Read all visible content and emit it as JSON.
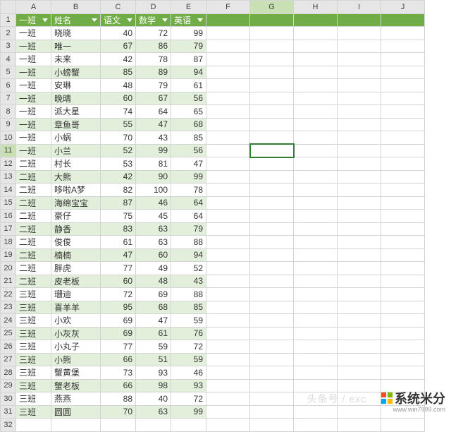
{
  "columns": [
    "A",
    "B",
    "C",
    "D",
    "E",
    "F",
    "G",
    "H",
    "I",
    "J"
  ],
  "col_classes": [
    "cA",
    "cB",
    "cC",
    "cD",
    "cE",
    "cF",
    "cG",
    "cH",
    "cI",
    "cJ"
  ],
  "header_row": [
    "一班",
    "姓名",
    "语文",
    "数学",
    "英语"
  ],
  "selected": {
    "row": 11,
    "col": "G"
  },
  "rows": [
    {
      "n": 2,
      "band": false,
      "c": [
        "一班",
        "晓晓",
        "40",
        "72",
        "99"
      ]
    },
    {
      "n": 3,
      "band": true,
      "c": [
        "一班",
        "唯一",
        "67",
        "86",
        "79"
      ]
    },
    {
      "n": 4,
      "band": false,
      "c": [
        "一班",
        "未来",
        "42",
        "78",
        "87"
      ]
    },
    {
      "n": 5,
      "band": true,
      "c": [
        "一班",
        "小螃蟹",
        "85",
        "89",
        "94"
      ]
    },
    {
      "n": 6,
      "band": false,
      "c": [
        "一班",
        "安琳",
        "48",
        "79",
        "61"
      ]
    },
    {
      "n": 7,
      "band": true,
      "c": [
        "一班",
        "晚晴",
        "60",
        "67",
        "56"
      ]
    },
    {
      "n": 8,
      "band": false,
      "c": [
        "一班",
        "派大星",
        "74",
        "64",
        "65"
      ]
    },
    {
      "n": 9,
      "band": true,
      "c": [
        "一班",
        "章鱼哥",
        "55",
        "47",
        "68"
      ]
    },
    {
      "n": 10,
      "band": false,
      "c": [
        "一班",
        "小蜗",
        "70",
        "43",
        "85"
      ]
    },
    {
      "n": 11,
      "band": true,
      "c": [
        "一班",
        "小兰",
        "52",
        "99",
        "56"
      ]
    },
    {
      "n": 12,
      "band": false,
      "c": [
        "二班",
        "村长",
        "53",
        "81",
        "47"
      ]
    },
    {
      "n": 13,
      "band": true,
      "c": [
        "二班",
        "大熊",
        "42",
        "90",
        "99"
      ]
    },
    {
      "n": 14,
      "band": false,
      "c": [
        "二班",
        "哆啦A梦",
        "82",
        "100",
        "78"
      ]
    },
    {
      "n": 15,
      "band": true,
      "c": [
        "二班",
        "海绵宝宝",
        "87",
        "46",
        "64"
      ]
    },
    {
      "n": 16,
      "band": false,
      "c": [
        "二班",
        "豪仔",
        "75",
        "45",
        "64"
      ]
    },
    {
      "n": 17,
      "band": true,
      "c": [
        "二班",
        "静香",
        "83",
        "63",
        "79"
      ]
    },
    {
      "n": 18,
      "band": false,
      "c": [
        "二班",
        "俊俊",
        "61",
        "63",
        "88"
      ]
    },
    {
      "n": 19,
      "band": true,
      "c": [
        "二班",
        "楠楠",
        "47",
        "60",
        "94"
      ]
    },
    {
      "n": 20,
      "band": false,
      "c": [
        "二班",
        "胖虎",
        "77",
        "49",
        "52"
      ]
    },
    {
      "n": 21,
      "band": true,
      "c": [
        "二班",
        "皮老板",
        "60",
        "48",
        "43"
      ]
    },
    {
      "n": 22,
      "band": false,
      "c": [
        "三班",
        "珊迪",
        "72",
        "69",
        "88"
      ]
    },
    {
      "n": 23,
      "band": true,
      "c": [
        "三班",
        "喜羊羊",
        "95",
        "68",
        "85"
      ]
    },
    {
      "n": 24,
      "band": false,
      "c": [
        "三班",
        "小欢",
        "69",
        "47",
        "59"
      ]
    },
    {
      "n": 25,
      "band": true,
      "c": [
        "三班",
        "小灰灰",
        "69",
        "61",
        "76"
      ]
    },
    {
      "n": 26,
      "band": false,
      "c": [
        "三班",
        "小丸子",
        "77",
        "59",
        "72"
      ]
    },
    {
      "n": 27,
      "band": true,
      "c": [
        "三班",
        "小熊",
        "66",
        "51",
        "59"
      ]
    },
    {
      "n": 28,
      "band": false,
      "c": [
        "三班",
        "蟹黄堡",
        "73",
        "93",
        "46"
      ]
    },
    {
      "n": 29,
      "band": true,
      "c": [
        "三班",
        "蟹老板",
        "66",
        "98",
        "93"
      ]
    },
    {
      "n": 30,
      "band": false,
      "c": [
        "三班",
        "燕燕",
        "88",
        "40",
        "72"
      ]
    },
    {
      "n": 31,
      "band": true,
      "c": [
        "三班",
        "圆圆",
        "70",
        "63",
        "99"
      ]
    }
  ],
  "blank_row": 32,
  "watermarks": {
    "wm1": "头条号 / exc",
    "wm2_main": "系统米分",
    "wm2_sub": "www.win7999.com"
  }
}
